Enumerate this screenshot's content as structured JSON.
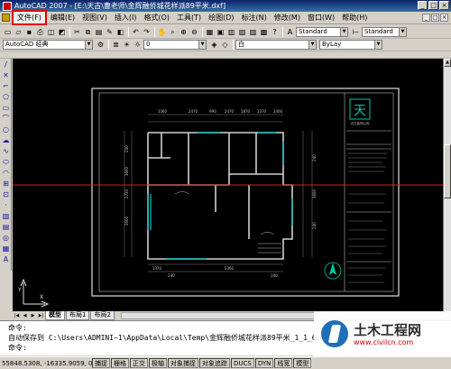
{
  "titlebar": {
    "title": "AutoCAD 2007 - [E:\\天古\\曹老师\\金辉融侨城花样派89平米.dxf]",
    "buttons": [
      "_",
      "□",
      "×"
    ]
  },
  "menubar": {
    "items": [
      "文件(F)",
      "编辑(E)",
      "视图(V)",
      "插入(I)",
      "格式(O)",
      "工具(T)",
      "绘图(D)",
      "标注(N)",
      "修改(M)",
      "窗口(W)",
      "帮助(H)"
    ],
    "active_index": 0,
    "doc_buttons": [
      "_",
      "□",
      "×"
    ]
  },
  "toolbar_row1": {
    "style_combo_1": "Standard",
    "style_combo_2": "Standard"
  },
  "toolbar_row2": {
    "workspace_combo": "AutoCAD 经典",
    "layer_combo": "0",
    "color_combo": "白",
    "linetype_combo": "ByLay"
  },
  "drawing": {
    "dims_top": [
      "3360",
      "2470",
      "990",
      "2470",
      "1870",
      "1370",
      "3400"
    ],
    "dims_bottom": [
      "1370",
      "240",
      "5360",
      "240"
    ],
    "dims_left": [
      "240",
      "3600",
      "2710",
      "3600"
    ],
    "dims_right": [
      "240",
      "3600",
      "240"
    ],
    "title_block_logo": "天",
    "title_block_name": "天古装饰公司"
  },
  "layout_tabs": {
    "tabs": [
      "模型",
      "布局1",
      "布局2"
    ],
    "active_index": 0,
    "nav": [
      "|◀",
      "◀",
      "▶",
      "▶|"
    ]
  },
  "command": {
    "lines": [
      "命令:",
      "自动保存到 C:\\Users\\ADMINI~1\\AppData\\Local\\Temp\\金辉融侨城花样派89平米_1_1_6",
      "命令:"
    ]
  },
  "statusbar": {
    "coords": "55848.5308, -16335.9059, 0.0000",
    "buttons": [
      "捕捉",
      "栅格",
      "正交",
      "极轴",
      "对象捕捉",
      "对象追踪",
      "DUCS",
      "DYN",
      "线宽",
      "模型"
    ]
  },
  "watermark": {
    "cn": "土木工程网",
    "url": "www.civilcn.com"
  },
  "colors": {
    "canvas_bg": "#000000",
    "crosshair": "#d42020",
    "wall": "#d0d0d0",
    "window_cyan": "#00c8c8",
    "menu_highlight": "#e00000"
  }
}
